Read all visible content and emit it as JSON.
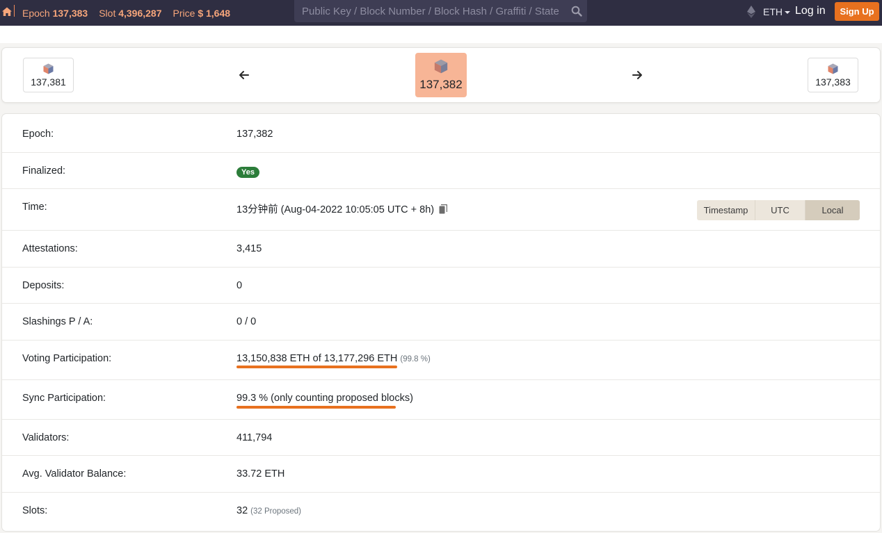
{
  "nav": {
    "epoch_label": "Epoch",
    "epoch_value": "137,383",
    "slot_label": "Slot",
    "slot_value": "4,396,287",
    "price_label": "Price",
    "price_value": "$ 1,648",
    "search_placeholder": "Public Key / Block Number / Block Hash / Graffiti / State",
    "currency": "ETH",
    "login": "Log in",
    "signup": "Sign Up",
    "accent_color": "#e8711f"
  },
  "epoch_nav": {
    "prev": "137,381",
    "current": "137,382",
    "next": "137,383"
  },
  "details": {
    "epoch": {
      "label": "Epoch:",
      "value": "137,382"
    },
    "finalized": {
      "label": "Finalized:",
      "value": "Yes"
    },
    "time": {
      "label": "Time:",
      "value": "13分钟前 (Aug-04-2022 10:05:05 UTC + 8h)",
      "buttons": [
        "Timestamp",
        "UTC",
        "Local"
      ],
      "active": "Local"
    },
    "attestations": {
      "label": "Attestations:",
      "value": "3,415"
    },
    "deposits": {
      "label": "Deposits:",
      "value": "0"
    },
    "slashings": {
      "label": "Slashings P / A:",
      "value": "0 / 0"
    },
    "voting": {
      "label": "Voting Participation:",
      "value": "13,150,838 ETH of 13,177,296 ETH",
      "note": "(99.8 %)"
    },
    "sync": {
      "label": "Sync Participation:",
      "value": "99.3 % (only counting proposed blocks)"
    },
    "validators": {
      "label": "Validators:",
      "value": "411,794"
    },
    "avg_balance": {
      "label": "Avg. Validator Balance:",
      "value": "33.72 ETH"
    },
    "slots": {
      "label": "Slots:",
      "value": "32",
      "note": "(32 Proposed)"
    }
  }
}
